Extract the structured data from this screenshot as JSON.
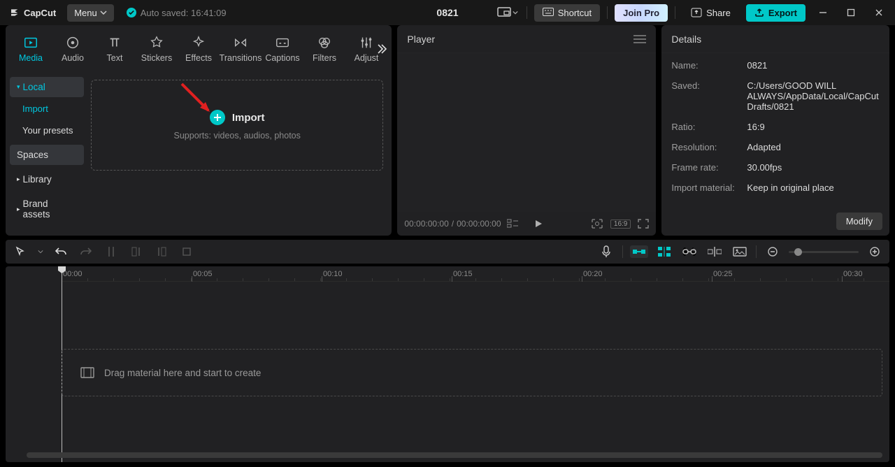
{
  "app": {
    "name": "CapCut"
  },
  "menu": {
    "label": "Menu"
  },
  "autosave": {
    "text": "Auto saved: 16:41:09"
  },
  "project": {
    "title": "0821"
  },
  "buttons": {
    "shortcut": "Shortcut",
    "joinpro": "Join Pro",
    "share": "Share",
    "export": "Export"
  },
  "tabs": [
    "Media",
    "Audio",
    "Text",
    "Stickers",
    "Effects",
    "Transitions",
    "Captions",
    "Filters",
    "Adjust"
  ],
  "sidebar": {
    "local": "Local",
    "import": "Import",
    "presets": "Your presets",
    "spaces": "Spaces",
    "library": "Library",
    "brand": "Brand assets"
  },
  "dropzone": {
    "label": "Import",
    "support": "Supports: videos, audios, photos"
  },
  "player": {
    "title": "Player",
    "time_current": "00:00:00:00",
    "time_total": "00:00:00:00",
    "ratio": "16:9"
  },
  "details": {
    "title": "Details",
    "name_label": "Name:",
    "name_value": "0821",
    "saved_label": "Saved:",
    "saved_value": "C:/Users/GOOD WILL ALWAYS/AppData/Local/CapCut Drafts/0821",
    "ratio_label": "Ratio:",
    "ratio_value": "16:9",
    "res_label": "Resolution:",
    "res_value": "Adapted",
    "fps_label": "Frame rate:",
    "fps_value": "30.00fps",
    "import_label": "Import material:",
    "import_value": "Keep in original place",
    "modify": "Modify"
  },
  "timeline": {
    "ticks": [
      "00:00",
      "00:05",
      "00:10",
      "00:15",
      "00:20",
      "00:25",
      "00:30"
    ],
    "hint": "Drag material here and start to create"
  }
}
